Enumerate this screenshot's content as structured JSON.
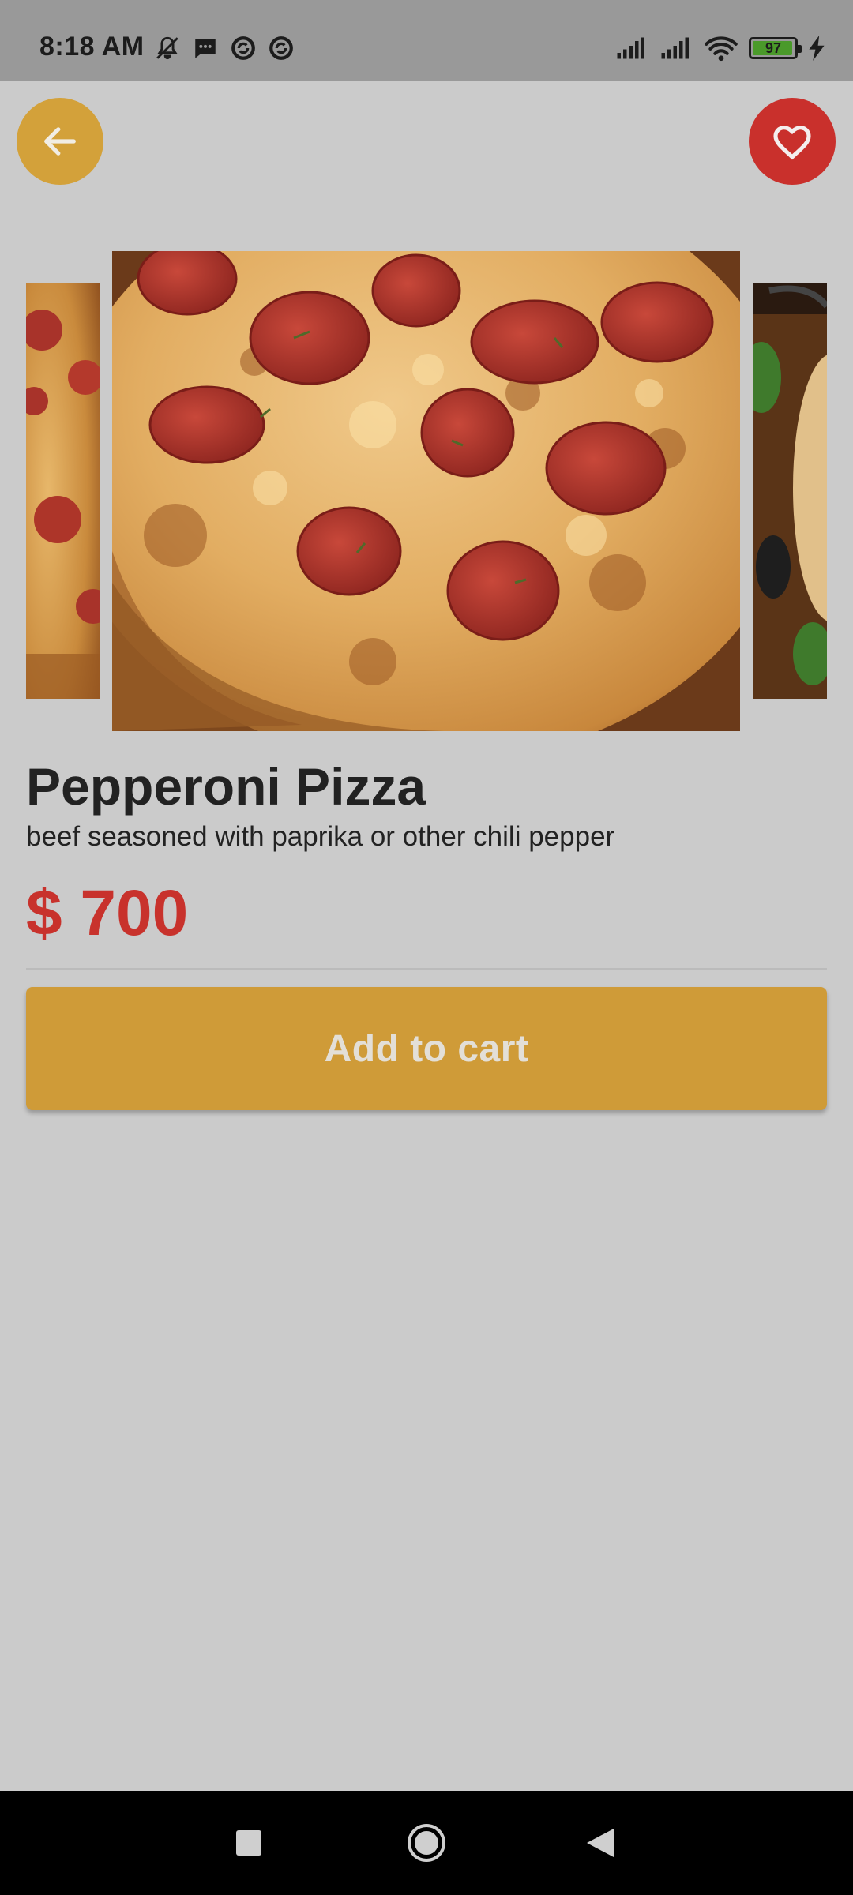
{
  "status_bar": {
    "time": "8:18 AM",
    "battery": "97",
    "battery_level": 0.97,
    "icons": [
      "mute-icon",
      "message-icon",
      "sync-icon",
      "sync-icon",
      "signal-icon",
      "signal-icon",
      "wifi-icon",
      "battery-icon",
      "charging-icon"
    ]
  },
  "header": {
    "back_icon": "arrow-left-icon",
    "favorite_icon": "heart-icon"
  },
  "product": {
    "name": "Pepperoni Pizza",
    "description": "beef seasoned with paprika or other chili pepper",
    "price": "$ 700",
    "add_to_cart_label": "Add to cart"
  },
  "carousel": {
    "image_subject": "pepperoni-pizza"
  },
  "colors": {
    "accent": "#d3a13a",
    "favorite": "#c9302c",
    "price": "#c8322c",
    "background": "#cbcbcb"
  },
  "nav_bar": {
    "icons": [
      "square-icon",
      "home-circle-icon",
      "back-triangle-icon"
    ]
  }
}
